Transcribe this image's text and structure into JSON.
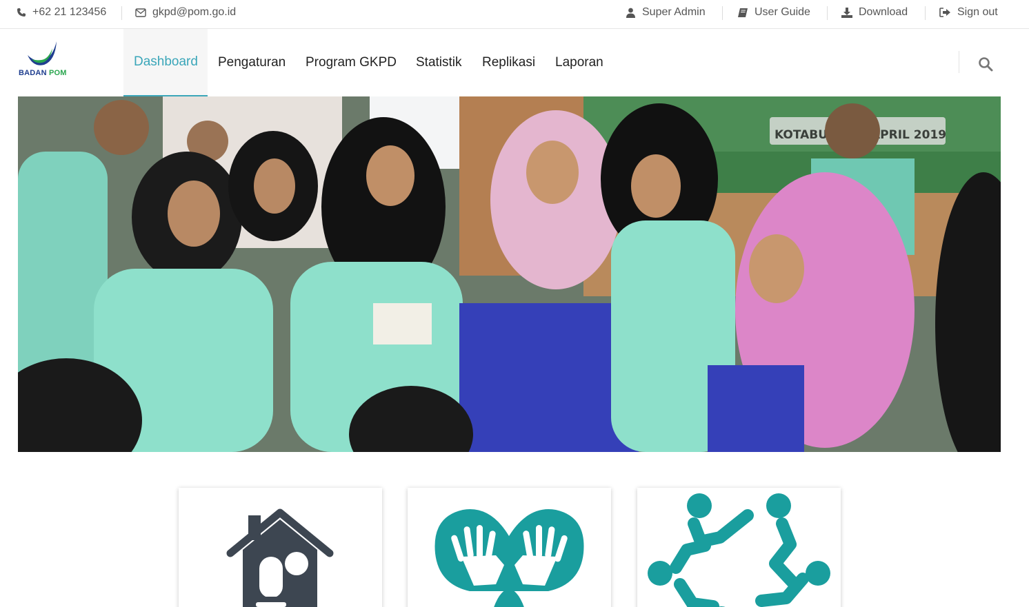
{
  "topbar": {
    "phone": "+62 21 123456",
    "email": "gkpd@pom.go.id",
    "user": "Super Admin",
    "user_guide": "User Guide",
    "download": "Download",
    "sign_out": "Sign out"
  },
  "brand": {
    "logo_text_1": "BADAN",
    "logo_text_2": "POM",
    "color_blue": "#1f3e8f",
    "color_green": "#2aa64f"
  },
  "nav": {
    "items": [
      {
        "label": "Dashboard",
        "active": true
      },
      {
        "label": "Pengaturan"
      },
      {
        "label": "Program GKPD"
      },
      {
        "label": "Statistik"
      },
      {
        "label": "Replikasi"
      },
      {
        "label": "Laporan"
      }
    ],
    "accent": "#3aa6b9",
    "search_icon": "search-icon"
  },
  "hero": {
    "banner_text_1": "KOTABU",
    "banner_text_2": "APRIL 2019"
  },
  "cards": [
    {
      "icon": "home-bulb-icon",
      "color": "#3d4651"
    },
    {
      "icon": "heart-hands-icon",
      "color": "#1a9e9e"
    },
    {
      "icon": "community-circle-icon",
      "color": "#1a9e9e"
    }
  ]
}
